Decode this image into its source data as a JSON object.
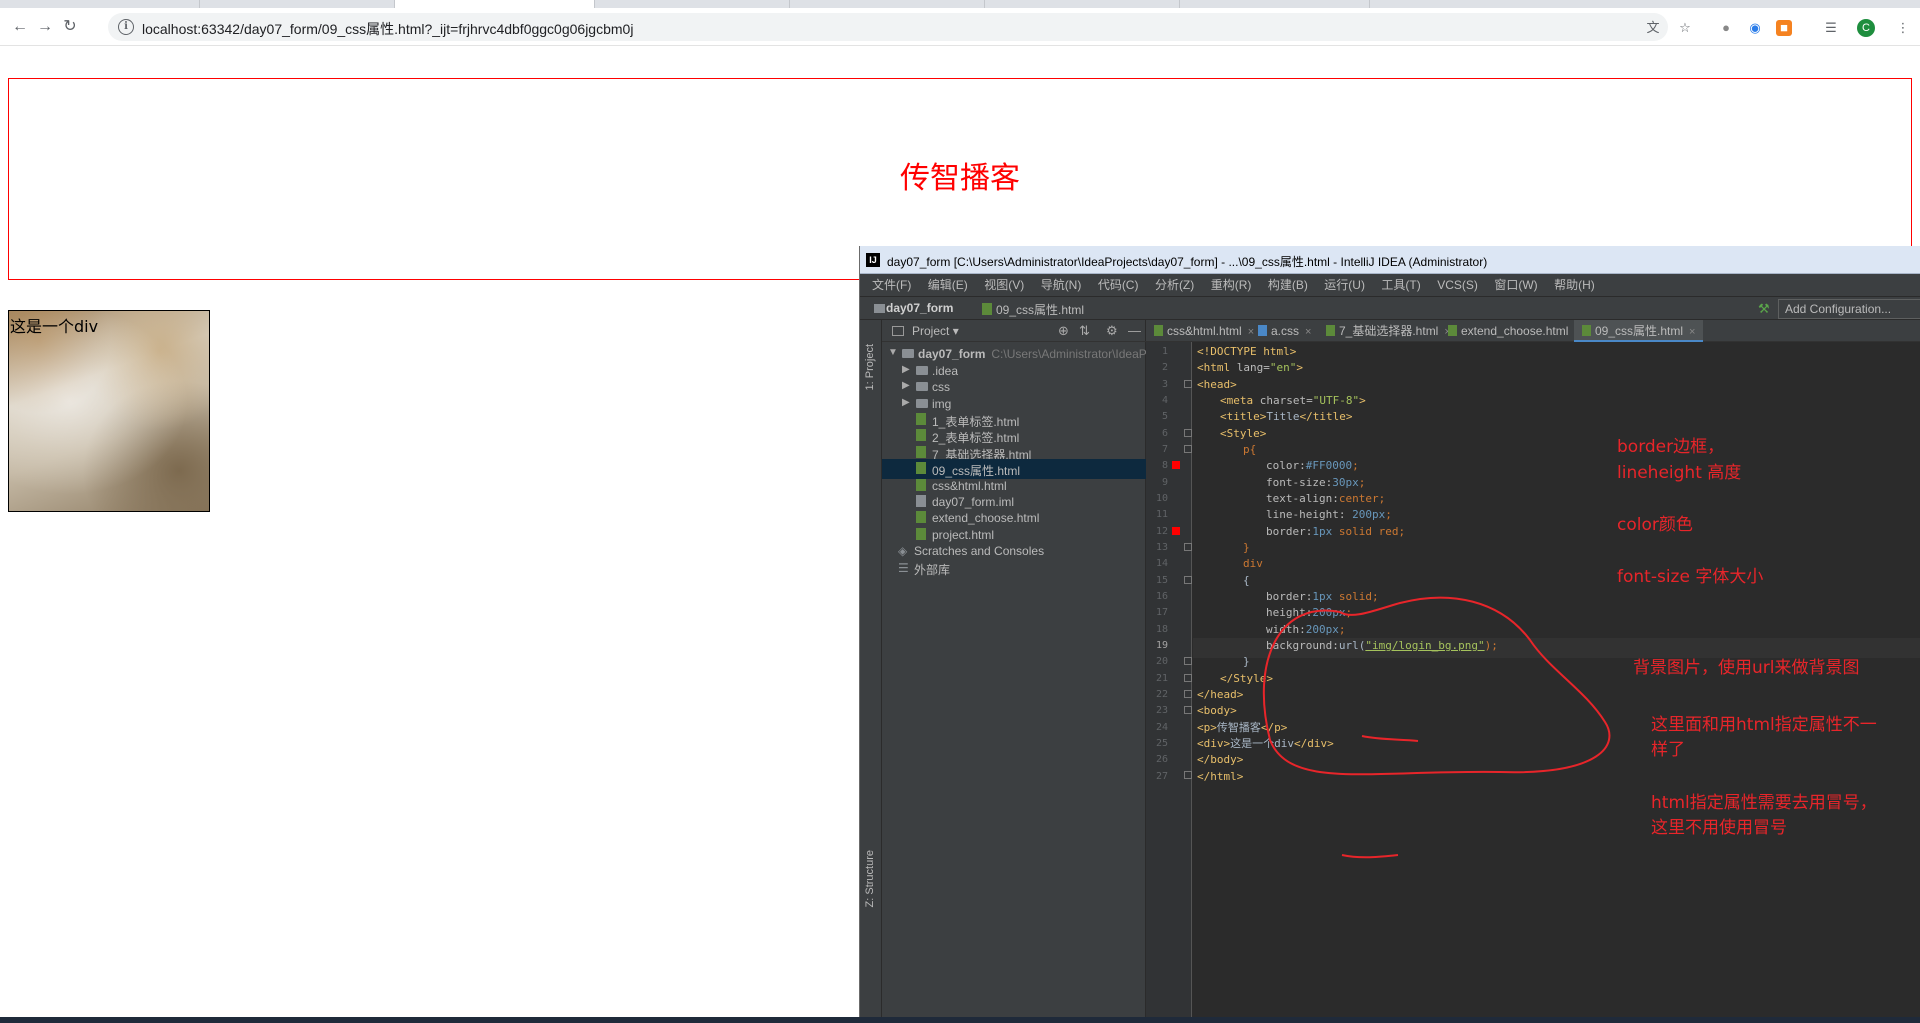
{
  "browser": {
    "url": "localhost:63342/day07_form/09_css属性.html?_ijt=frjhrvc4dbf0ggc0g06jgcbm0j"
  },
  "page": {
    "p_text": "传智播客",
    "div_text": "这是一个div"
  },
  "ide": {
    "title": "day07_form [C:\\Users\\Administrator\\IdeaProjects\\day07_form] - ...\\09_css属性.html - IntelliJ IDEA (Administrator)",
    "menu": [
      "文件(F)",
      "编辑(E)",
      "视图(V)",
      "导航(N)",
      "代码(C)",
      "分析(Z)",
      "重构(R)",
      "构建(B)",
      "运行(U)",
      "工具(T)",
      "VCS(S)",
      "窗口(W)",
      "帮助(H)"
    ],
    "breadcrumb": {
      "project": "day07_form",
      "file": "09_css属性.html"
    },
    "add_config": "Add Configuration...",
    "sidebar_project": "1: Project",
    "sidebar_structure": "Z: Structure",
    "project_panel": {
      "title": "Project",
      "root": "day07_form",
      "root_path": "C:\\Users\\Administrator\\IdeaProjects\\day07_form",
      "folders": [
        ".idea",
        "css",
        "img"
      ],
      "files": [
        "1_表单标签.html",
        "2_表单标签.html",
        "7_基础选择器.html",
        "09_css属性.html",
        "css&html.html",
        "day07_form.iml",
        "extend_choose.html",
        "project.html"
      ],
      "scratches": "Scratches and Consoles",
      "external": "外部库"
    },
    "tabs": [
      "css&html.html",
      "a.css",
      "7_基础选择器.html",
      "extend_choose.html",
      "09_css属性.html"
    ],
    "line_numbers": [
      "1",
      "2",
      "3",
      "4",
      "5",
      "6",
      "7",
      "8",
      "9",
      "10",
      "11",
      "12",
      "13",
      "14",
      "15",
      "16",
      "17",
      "18",
      "19",
      "20",
      "21",
      "22",
      "23",
      "24",
      "25",
      "26",
      "27"
    ],
    "code": {
      "l1": "<!DOCTYPE html>",
      "l2_tag": "<html ",
      "l2_attr": "lang=",
      "l2_str": "\"en\"",
      "l2_end": ">",
      "l3": "<head>",
      "l4_tag": "<meta ",
      "l4_attr": "charset=",
      "l4_str": "\"UTF-8\"",
      "l4_end": ">",
      "l5_a": "<title>",
      "l5_b": "Title",
      "l5_c": "</title>",
      "l6": "<Style>",
      "l7": "p{",
      "l8_p": "color:",
      "l8_v": "#FF0000",
      "l8_e": ";",
      "l9_p": "font-size:",
      "l9_v": "30px",
      "l9_e": ";",
      "l10_p": "text-align:",
      "l10_v": "center",
      "l10_e": ";",
      "l11_p": "line-height: ",
      "l11_v": "200px",
      "l11_e": ";",
      "l12_p": "border:",
      "l12_v": "1px",
      "l12_w": " solid red",
      "l12_e": ";",
      "l13": "}",
      "l14": "div",
      "l15": "{",
      "l16_p": "border:",
      "l16_v": "1px",
      "l16_w": " solid",
      "l16_e": ";",
      "l17_p": "height:",
      "l17_v": "200px",
      "l17_e": ";",
      "l18_p": "width:",
      "l18_v": "200px",
      "l18_e": ";",
      "l19_p": "background:",
      "l19_f": "url(",
      "l19_s": "\"img/login_bg.png\"",
      "l19_e": ");",
      "l20": "}",
      "l21": "</Style>",
      "l22": "</head>",
      "l23": "<body>",
      "l24_a": "<p>",
      "l24_b": "传智播客",
      "l24_c": "</p>",
      "l25_a": "<div>",
      "l25_b": "这是一个div",
      "l25_c": "</div>",
      "l26": "</body>",
      "l27": "</html>"
    },
    "notes": {
      "n1": "border边框，",
      "n2": "lineheight 高度",
      "n3": "color颜色",
      "n4": "font-size 字体大小",
      "n5": "背景图片，使用url来做背景图",
      "n6": "这里面和用html指定属性不一",
      "n7": "样了",
      "n8": "html指定属性需要去用冒号，",
      "n9": "这里不用使用冒号"
    }
  },
  "colors": {
    "page_red": "#FF0000",
    "annotation_red": "#e8252a",
    "ide_bg": "#2b2b2b"
  },
  "icons": [
    "back-icon",
    "forward-icon",
    "reload-icon",
    "info-icon",
    "translate-icon",
    "star-icon",
    "extension-icon",
    "menu-icon",
    "folder-icon",
    "html-file-icon",
    "hammer-icon",
    "gear-icon"
  ]
}
